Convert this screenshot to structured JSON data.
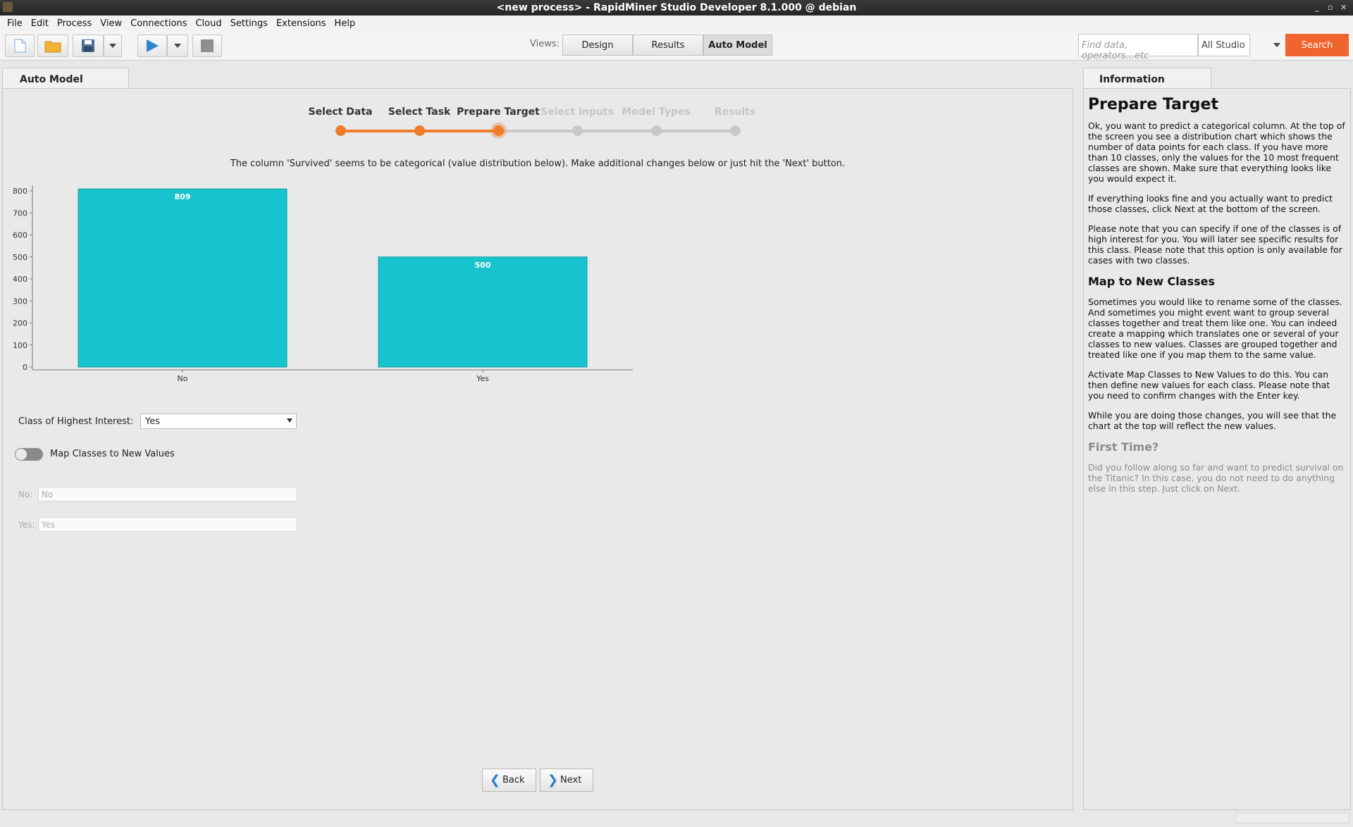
{
  "window": {
    "title": "<new process> - RapidMiner Studio Developer 8.1.000 @ debian"
  },
  "menu": [
    "File",
    "Edit",
    "Process",
    "View",
    "Connections",
    "Cloud",
    "Settings",
    "Extensions",
    "Help"
  ],
  "toolbar": {
    "views_label": "Views:",
    "views": [
      "Design",
      "Results",
      "Auto Model"
    ],
    "search_placeholder": "Find data, operators...etc",
    "search_scope": "All Studio",
    "search_button": "Search"
  },
  "main": {
    "tab_label": "Auto Model",
    "steps": [
      "Select Data",
      "Select Task",
      "Prepare Target",
      "Select Inputs",
      "Model Types",
      "Results"
    ],
    "current_step": 2,
    "message": "The column 'Survived' seems to be categorical (value distribution below).  Make additional changes below or just hit the 'Next' button.",
    "class_interest_label": "Class of Highest Interest:",
    "class_interest_value": "Yes",
    "map_toggle_label": "Map Classes to New Values",
    "map_fields": [
      {
        "label": "No:",
        "value": "No"
      },
      {
        "label": "Yes:",
        "value": "Yes"
      }
    ],
    "back_label": "Back",
    "next_label": "Next"
  },
  "chart_data": {
    "type": "bar",
    "categories": [
      "No",
      "Yes"
    ],
    "values": [
      809,
      500
    ],
    "ylim": [
      0,
      800
    ],
    "yticks": [
      0,
      100,
      200,
      300,
      400,
      500,
      600,
      700,
      800
    ],
    "bar_color": "#17c3cc"
  },
  "info": {
    "tab_label": "Information",
    "title": "Prepare Target",
    "p1": "Ok, you want to predict a categorical column. At the top of the screen you see a distribution chart which shows the number of data points for each class. If you have more than 10 classes, only the values for the 10 most frequent classes are shown. Make sure that everything looks like you would expect it.",
    "p2": "If everything looks fine and you actually want to predict those classes, click Next at the bottom of the screen.",
    "p3": "Please note that you can specify if one of the classes is of high interest for you. You will later see specific results for this class. Please note that this option is only available for cases with two classes.",
    "h_map": "Map to New Classes",
    "p4": "Sometimes you would like to rename some of the classes. And sometimes you might event want to group several classes together and treat them like one. You can indeed create a mapping which translates one or several of your classes to new values. Classes are grouped together and treated like one if you map them to the same value.",
    "p5": "Activate Map Classes to New Values to do this. You can then define new values for each class. Please note that you need to confirm changes with the Enter key.",
    "p6": "While you are doing those changes, you will see that the chart at the top will reflect the new values.",
    "h_first": "First Time?",
    "p7": "Did you follow along so far and want to predict survival on the Titanic? In this case, you do not need to do anything else in this step. Just click on Next."
  },
  "colors": {
    "accent": "#f07b2a",
    "inactive": "#c8c8c8",
    "search": "#f0642d"
  }
}
